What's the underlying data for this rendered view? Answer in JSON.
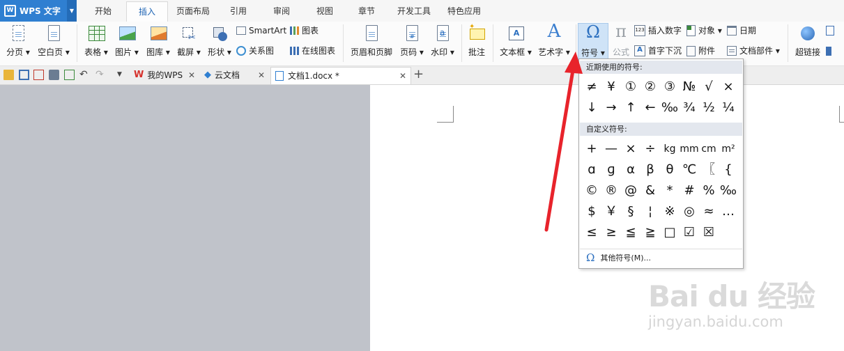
{
  "app": {
    "title": "WPS 文字"
  },
  "menu": {
    "tabs": [
      "开始",
      "插入",
      "页面布局",
      "引用",
      "审阅",
      "视图",
      "章节",
      "开发工具",
      "特色应用"
    ],
    "active_tab": "插入"
  },
  "ribbon": {
    "page_break": "分页",
    "blank_page": "空白页",
    "table": "表格",
    "picture": "图片",
    "gallery": "图库",
    "screenshot": "截屏",
    "shapes": "形状",
    "smartart": "SmartArt",
    "chart": "图表",
    "relation_chart": "关系图",
    "online_chart": "在线图表",
    "header_footer": "页眉和页脚",
    "page_number": "页码",
    "watermark": "水印",
    "comment": "批注",
    "textbox": "文本框",
    "wordart": "艺术字",
    "symbol": "符号",
    "formula": "公式",
    "insert_number": "插入数字",
    "object": "对象",
    "date": "日期",
    "drop_cap": "首字下沉",
    "attachment": "附件",
    "doc_parts": "文档部件",
    "hyperlink": "超链接"
  },
  "doc_tabs": [
    {
      "label": "我的WPS"
    },
    {
      "label": "云文档"
    },
    {
      "label": "文档1.docx *"
    }
  ],
  "symbols": {
    "recent_header": "近期使用的符号:",
    "recent": [
      "≠",
      "¥",
      "①",
      "②",
      "③",
      "№",
      "√",
      "×",
      "↓",
      "→",
      "↑",
      "←",
      "‰",
      "¾",
      "½",
      "¼"
    ],
    "custom_header": "自定义符号:",
    "custom": [
      "+",
      "—",
      "×",
      "÷",
      "kg",
      "mm",
      "cm",
      "m²",
      "ɑ",
      "ɡ",
      "α",
      "β",
      "θ",
      "℃",
      "〖",
      "{",
      "©",
      "®",
      "@",
      "&",
      "*",
      "#",
      "%",
      "‰",
      "$",
      "￥",
      "§",
      "¦",
      "※",
      "◎",
      "≈",
      "…",
      "≤",
      "≥",
      "≦",
      "≧",
      "□",
      "☑",
      "☒"
    ],
    "more": "其他符号(M)..."
  },
  "watermark": {
    "main": "Bai du 经验",
    "url": "jingyan.baidu.com"
  },
  "colors": {
    "accent": "#2f7fd1",
    "arrow": "#e8232b",
    "ribbon_bg": "#fbfbfb",
    "workspace": "#c0c3ca"
  }
}
